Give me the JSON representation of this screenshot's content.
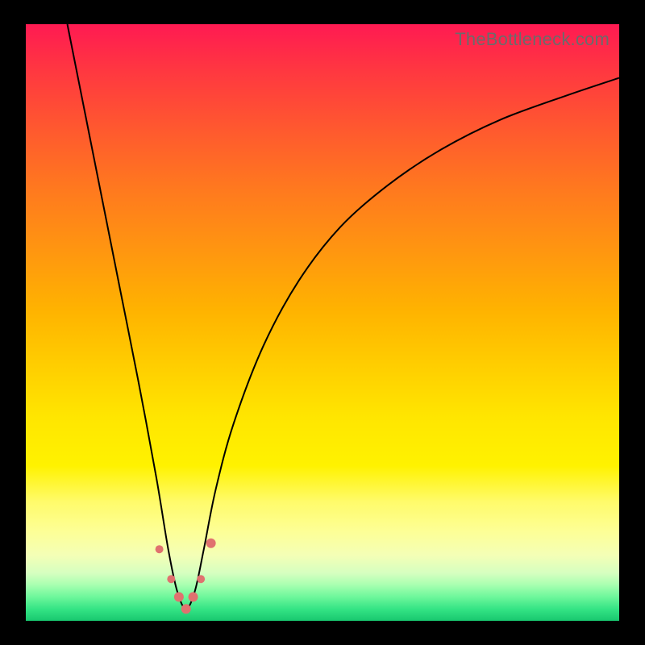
{
  "watermark": "TheBottleneck.com",
  "colors": {
    "curve": "#000000",
    "dot": "#e0726f",
    "frame_bg_top": "#ff1a52",
    "frame_bg_bottom": "#18c86f",
    "page_bg": "#000000"
  },
  "chart_data": {
    "type": "line",
    "title": "",
    "xlabel": "",
    "ylabel": "",
    "xlim": [
      0,
      100
    ],
    "ylim": [
      0,
      100
    ],
    "grid": false,
    "note": "V-shaped curve; minimum at x≈27; values read off plot (100=top, 0=bottom). Left branch steeper than right.",
    "series": [
      {
        "name": "curve",
        "x": [
          7,
          10,
          13,
          16,
          19,
          22,
          24,
          25.5,
          27,
          28.5,
          30,
          32,
          35,
          40,
          46,
          53,
          61,
          70,
          80,
          91,
          100
        ],
        "values": [
          100,
          85,
          70,
          55,
          40,
          24,
          12,
          5,
          2,
          5,
          12,
          22,
          33,
          46,
          57,
          66,
          73,
          79,
          84,
          88,
          91
        ]
      }
    ],
    "markers": {
      "name": "dots-near-minimum",
      "x": [
        22.5,
        24.5,
        25.8,
        27,
        28.2,
        29.5,
        31.2
      ],
      "values": [
        12,
        7,
        4,
        2,
        4,
        7,
        13
      ],
      "r": [
        5,
        5,
        6,
        6,
        6,
        5,
        6
      ]
    }
  }
}
